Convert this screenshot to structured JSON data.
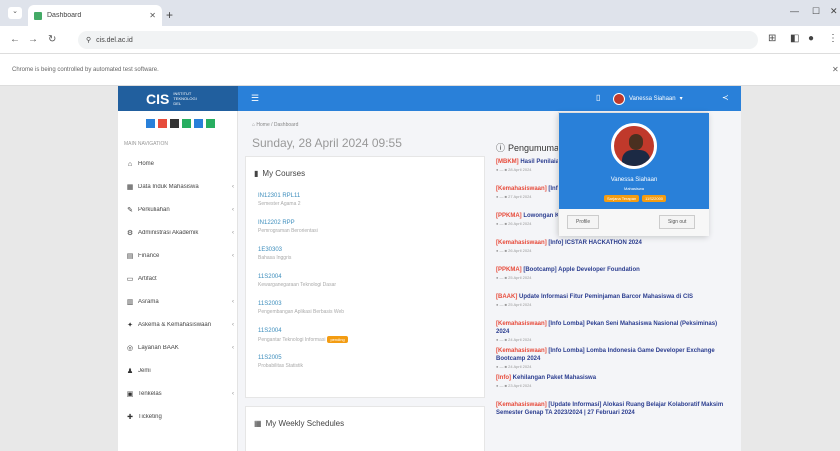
{
  "browser": {
    "tab_title": "Dashboard",
    "tab_close": "✕",
    "new_tab": "+",
    "url": "cis.del.ac.id",
    "automation_notice": "Chrome is being controlled by automated test software."
  },
  "app": {
    "logo": "CIS",
    "logo_sub": "INSTITUT TEKNOLOGI DEL",
    "user_name": "Vanessa Siahaan"
  },
  "sidebar": {
    "heading": "MAIN NAVIGATION",
    "items": [
      {
        "label": "Home",
        "icon": "home-icon",
        "glyph": "⌂",
        "caret": ""
      },
      {
        "label": "Data Induk Mahasiswa",
        "icon": "database-icon",
        "glyph": "▦",
        "caret": "‹"
      },
      {
        "label": "Perkuliahan",
        "icon": "book-icon",
        "glyph": "✎",
        "caret": "‹"
      },
      {
        "label": "Administrasi Akademik",
        "icon": "admin-icon",
        "glyph": "⚙",
        "caret": "‹"
      },
      {
        "label": "Finance",
        "icon": "finance-icon",
        "glyph": "▤",
        "caret": "‹"
      },
      {
        "label": "Artifact",
        "icon": "file-icon",
        "glyph": "▭",
        "caret": ""
      },
      {
        "label": "Asrama",
        "icon": "dorm-icon",
        "glyph": "▥",
        "caret": "‹"
      },
      {
        "label": "Askema & Kemahasiswaan",
        "icon": "student-icon",
        "glyph": "✦",
        "caret": "‹"
      },
      {
        "label": "Layanan BAAK",
        "icon": "service-icon",
        "glyph": "◎",
        "caret": "‹"
      },
      {
        "label": "Jemi",
        "icon": "user-icon",
        "glyph": "♟",
        "caret": ""
      },
      {
        "label": "Tenkelas",
        "icon": "calendar-icon",
        "glyph": "▣",
        "caret": "‹"
      },
      {
        "label": "Ticketing",
        "icon": "ticket-icon",
        "glyph": "✚",
        "caret": ""
      }
    ]
  },
  "main": {
    "breadcrumb": "⌂ Home / Dashboard",
    "date": "Sunday, 28 April 2024 09:55",
    "courses_title": "My Courses",
    "courses": [
      {
        "code": "IN12301 RPL11",
        "sub": "Semester Agama 2",
        "badge": ""
      },
      {
        "code": "IN12202 RPP",
        "sub": "Pemrograman Berorientasi",
        "badge": ""
      },
      {
        "code": "1E30303",
        "sub": "Bahasa Inggris",
        "badge": ""
      },
      {
        "code": "11S2004",
        "sub": "Kewarganegaraan Teknologi Dasar",
        "badge": ""
      },
      {
        "code": "11S2003",
        "sub": "Pengembangan Aplikasi Berbasis Web",
        "badge": ""
      },
      {
        "code": "11S2004",
        "sub": "Pengantar Teknologi Informasi",
        "badge": "pending"
      },
      {
        "code": "11S2005",
        "sub": "Probabilitas Statistik",
        "badge": ""
      }
    ],
    "schedule_title": "My Weekly Schedules",
    "announcement_title": "Pengumuman",
    "announcements": [
      {
        "tag": "[MBKM]",
        "title": "Hasil Penilaian Kampus Merdeka",
        "meta": "● — ■ 28 April 2024"
      },
      {
        "tag": "[Kemahasiswaan]",
        "title": "[Info Lomba] Pekan Seni Mahasiswa [PIMNAS]",
        "meta": "● — ■ 27 April 2024"
      },
      {
        "tag": "[PPKMA]",
        "title": "Lowongan Kerja",
        "meta": "● — ■ 26 April 2024"
      },
      {
        "tag": "[Kemahasiswaan]",
        "title": "[Info] ICSTAR HACKATHON 2024",
        "meta": "● — ■ 26 April 2024"
      },
      {
        "tag": "[PPKMA]",
        "title": "[Bootcamp] Apple Developer Foundation",
        "meta": "● — ■ 25 April 2024"
      },
      {
        "tag": "[BAAK]",
        "title": "Update Informasi Fitur Peminjaman Barcor Mahasiswa di CIS",
        "meta": "● — ■ 25 April 2024"
      },
      {
        "tag": "[Kemahasiswaan]",
        "title": "[Info Lomba] Pekan Seni Mahasiswa Nasional (Peksiminas) 2024",
        "meta": "● — ■ 24 April 2024"
      },
      {
        "tag": "[Kemahasiswaan]",
        "title": "[Info Lomba] Lomba Indonesia Game Developer Exchange Bootcamp 2024",
        "meta": "● — ■ 24 April 2024"
      },
      {
        "tag": "[Info]",
        "title": "Kehilangan Paket Mahasiswa",
        "meta": "● — ■ 23 April 2024"
      },
      {
        "tag": "[Kemahasiswaan]",
        "title": "[Update Informasi] Alokasi Ruang Belajar Kolaboratif Maksim Semester Genap TA 2023/2024 | 27 Februari 2024",
        "meta": ""
      }
    ]
  },
  "dropdown": {
    "name": "Vanessa Siahaan",
    "role": "Mahasiswa",
    "badge1": "Sarjana Terapan",
    "badge2": "11S22000",
    "profile_btn": "Profile",
    "signout_btn": "Sign out"
  }
}
